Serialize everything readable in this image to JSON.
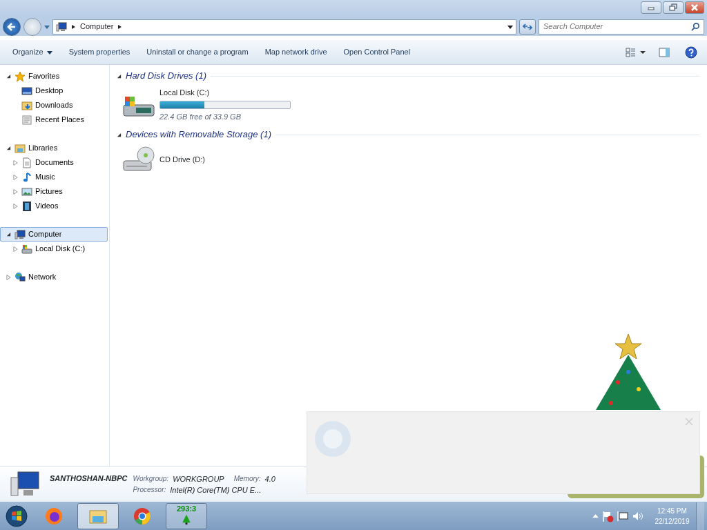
{
  "address_bar": {
    "path": [
      "Computer"
    ]
  },
  "search": {
    "placeholder": "Search Computer"
  },
  "toolbar": {
    "commands": [
      {
        "label": "Organize",
        "dropdown": true
      },
      {
        "label": "System properties",
        "dropdown": false
      },
      {
        "label": "Uninstall or change a program",
        "dropdown": false
      },
      {
        "label": "Map network drive",
        "dropdown": false
      },
      {
        "label": "Open Control Panel",
        "dropdown": false
      }
    ]
  },
  "navigation": [
    {
      "label": "Favorites",
      "kind": "star",
      "expanded": true,
      "selected": false,
      "children": [
        {
          "label": "Desktop",
          "kind": "desktop",
          "selected": false
        },
        {
          "label": "Downloads",
          "kind": "downloads",
          "selected": false
        },
        {
          "label": "Recent Places",
          "kind": "recent",
          "selected": false
        }
      ]
    },
    {
      "label": "Libraries",
      "kind": "library",
      "expanded": true,
      "selected": false,
      "children": [
        {
          "label": "Documents",
          "kind": "document",
          "expanded": false,
          "selected": false
        },
        {
          "label": "Music",
          "kind": "music",
          "expanded": false,
          "selected": false
        },
        {
          "label": "Pictures",
          "kind": "pictures",
          "expanded": false,
          "selected": false
        },
        {
          "label": "Videos",
          "kind": "videos",
          "expanded": false,
          "selected": false
        }
      ]
    },
    {
      "label": "Computer",
      "kind": "computer",
      "expanded": true,
      "selected": true,
      "children": [
        {
          "label": "Local Disk (C:)",
          "kind": "disk",
          "expanded": false,
          "selected": false
        }
      ]
    },
    {
      "label": "Network",
      "kind": "network",
      "expanded": false,
      "selected": false
    }
  ],
  "content": {
    "groups": [
      {
        "title": "Hard Disk Drives (1)",
        "expanded": true,
        "items": [
          {
            "name": "Local Disk (C:)",
            "kind": "disk",
            "level": 0.34,
            "free_space": "22.4 GB free of 33.9 GB"
          }
        ]
      },
      {
        "title": "Devices with Removable Storage (1)",
        "expanded": true,
        "items": [
          {
            "name": "CD Drive (D:)",
            "kind": "cd"
          }
        ]
      }
    ]
  },
  "details": {
    "computer_name": "SANTHOSHAN-NBPC",
    "fields": [
      {
        "label": "Workgroup:",
        "value": "WORKGROUP"
      },
      {
        "label": "Memory:",
        "value": "4.0"
      },
      {
        "label": "Processor:",
        "value": "Intel(R) Core(TM) CPU E..."
      }
    ]
  },
  "taskbar": {
    "items": [
      {
        "kind": "firefox",
        "selected": false
      },
      {
        "kind": "explorer",
        "selected": true
      },
      {
        "kind": "chrome",
        "selected": false
      },
      {
        "kind": "tree",
        "selected": false,
        "label": "293:3"
      }
    ]
  },
  "tray": {
    "time": "12:45 PM",
    "date": "22/12/2019"
  }
}
